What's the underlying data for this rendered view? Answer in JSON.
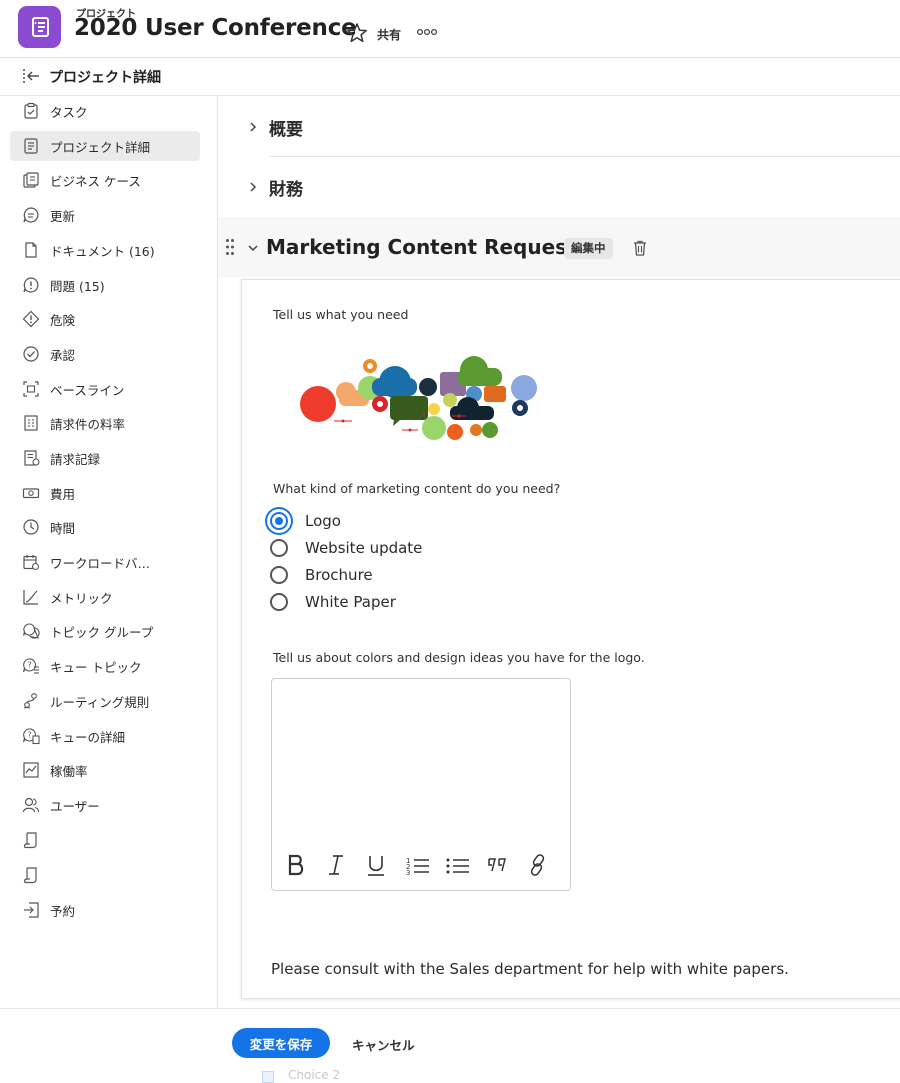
{
  "header": {
    "eyebrow": "プロジェクト",
    "title": "2020 User Conference",
    "share_label": "共有",
    "icons": {
      "app": "project-icon",
      "favorite": "star-icon",
      "more": "more-icon"
    }
  },
  "subheader": {
    "title": "プロジェクト詳細",
    "icon": "collapse-panel-icon"
  },
  "sidebar": {
    "items": [
      {
        "label": "タスク",
        "icon": "task-icon"
      },
      {
        "label": "プロジェクト詳細",
        "icon": "details-icon",
        "active": true
      },
      {
        "label": "ビジネス ケース",
        "icon": "business-case-icon"
      },
      {
        "label": "更新",
        "icon": "updates-icon"
      },
      {
        "label": "ドキュメント (16)",
        "icon": "document-icon"
      },
      {
        "label": "問題 (15)",
        "icon": "issue-icon"
      },
      {
        "label": "危険",
        "icon": "risk-icon"
      },
      {
        "label": "承認",
        "icon": "approval-icon"
      },
      {
        "label": "ベースライン",
        "icon": "baseline-icon"
      },
      {
        "label": "請求件の料率",
        "icon": "billing-rates-icon"
      },
      {
        "label": "請求記録",
        "icon": "billing-records-icon"
      },
      {
        "label": "費用",
        "icon": "expense-icon"
      },
      {
        "label": "時間",
        "icon": "clock-icon"
      },
      {
        "label": "ワークロードバ…",
        "icon": "workload-icon"
      },
      {
        "label": "メトリック",
        "icon": "metrics-icon"
      },
      {
        "label": "トピック グループ",
        "icon": "topic-group-icon"
      },
      {
        "label": "キュー トピック",
        "icon": "queue-topic-icon"
      },
      {
        "label": "ルーティング規則",
        "icon": "routing-icon"
      },
      {
        "label": "キューの詳細",
        "icon": "queue-details-icon"
      },
      {
        "label": "稼働率",
        "icon": "utilization-icon"
      },
      {
        "label": "ユーザー",
        "icon": "users-icon"
      },
      {
        "label": "",
        "icon": "scroll-icon"
      },
      {
        "label": "",
        "icon": "scroll-icon"
      },
      {
        "label": "予約",
        "icon": "booking-icon"
      }
    ]
  },
  "main": {
    "sections": [
      {
        "label": "概要"
      },
      {
        "label": "財務"
      }
    ],
    "form": {
      "title": "Marketing Content Request",
      "status_badge": "編集中",
      "intro_label": "Tell us what you need",
      "question": "What kind of marketing content do you need?",
      "options": [
        {
          "label": "Logo",
          "selected": true
        },
        {
          "label": "Website update",
          "selected": false
        },
        {
          "label": "Brochure",
          "selected": false
        },
        {
          "label": "White Paper",
          "selected": false
        }
      ],
      "textarea_label": "Tell us about colors and design ideas you have for the logo.",
      "toolbar": [
        "bold",
        "italic",
        "underline",
        "numbered-list",
        "bullet-list",
        "quote",
        "link"
      ],
      "note": "Please consult with the Sales department for help with white papers."
    }
  },
  "footer": {
    "save_label": "変更を保存",
    "cancel_label": "キャンセル",
    "ghost_label": "Choice 2"
  },
  "colors": {
    "accent": "#1473e6",
    "app_icon": "#8a4bd1",
    "active_item_bg": "#ebebeb"
  }
}
